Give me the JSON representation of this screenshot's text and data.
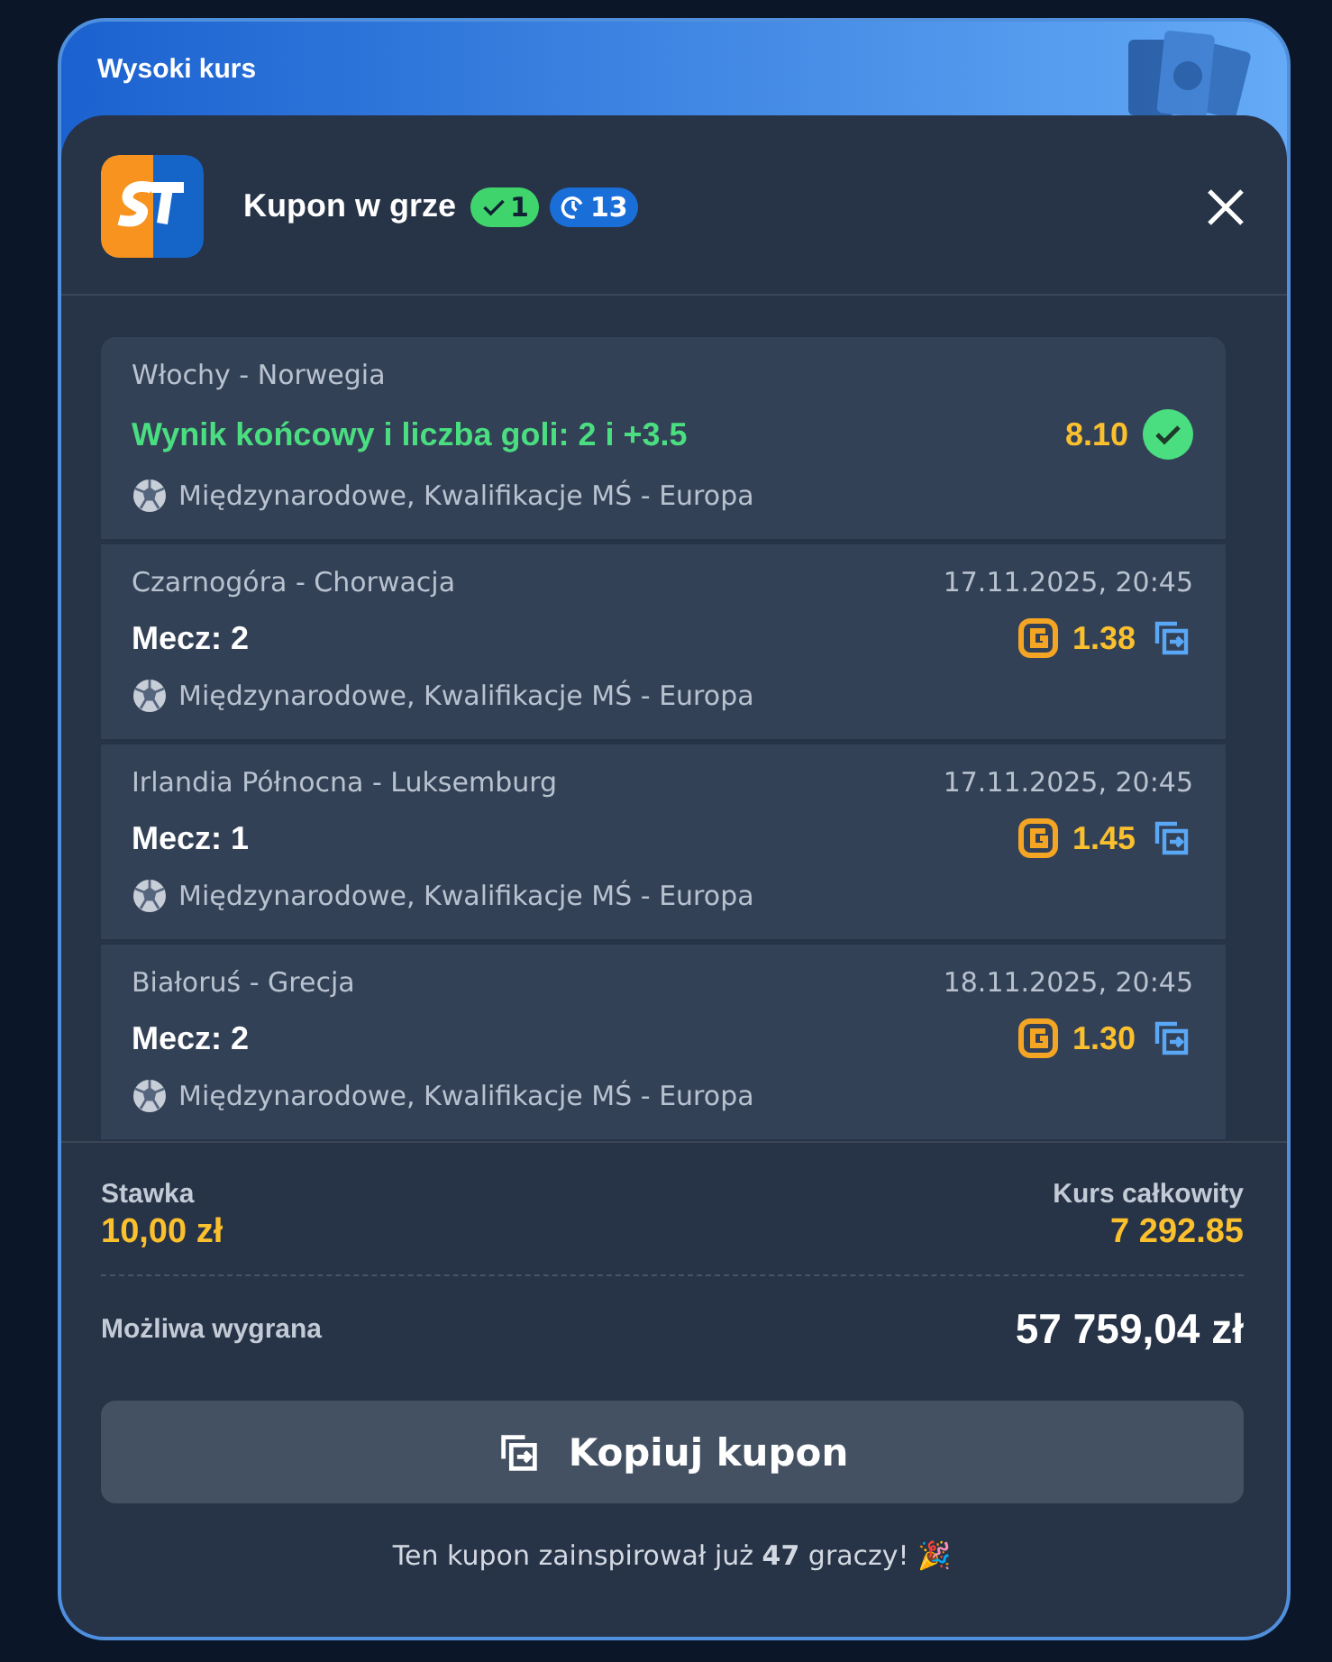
{
  "banner": {
    "title": "Wysoki kurs"
  },
  "coupon": {
    "title": "Kupon w grze",
    "won_count": "1",
    "pending_count": "13"
  },
  "bets": [
    {
      "kind": "won",
      "match": "Włochy - Norwegia",
      "pick": "Wynik końcowy i liczba goli: 2 i +3.5",
      "odds": "8.10",
      "league": "Międzynarodowe, Kwalifikacje MŚ - Europa"
    },
    {
      "kind": "pending",
      "match": "Czarnogóra - Chorwacja",
      "date": "17.11.2025, 20:45",
      "pick": "Mecz: 2",
      "odds": "1.38",
      "league": "Międzynarodowe, Kwalifikacje MŚ - Europa"
    },
    {
      "kind": "pending",
      "match": "Irlandia Północna - Luksemburg",
      "date": "17.11.2025, 20:45",
      "pick": "Mecz: 1",
      "odds": "1.45",
      "league": "Międzynarodowe, Kwalifikacje MŚ - Europa"
    },
    {
      "kind": "pending",
      "match": "Białoruś - Grecja",
      "date": "18.11.2025, 20:45",
      "pick": "Mecz: 2",
      "odds": "1.30",
      "league": "Międzynarodowe, Kwalifikacje MŚ - Europa"
    }
  ],
  "summary": {
    "stake_label": "Stawka",
    "stake": "10,00 zł",
    "total_odds_label": "Kurs całkowity",
    "total_odds": "7 292.85",
    "win_label": "Możliwa wygrana",
    "win": "57 759,04 zł"
  },
  "copy_button": "Kopiuj kupon",
  "footer_note": "Ten kupon zainspirował już **47** graczy! 🎉"
}
